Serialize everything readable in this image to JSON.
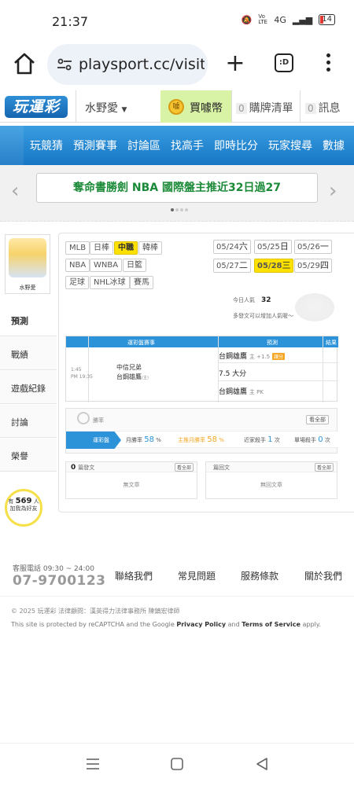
{
  "status_bar": {
    "time": "21:37",
    "signal_label": "Vo LTE",
    "network": "4G",
    "battery": "14"
  },
  "browser": {
    "url": "playsport.cc/visit",
    "tab_count": ":D"
  },
  "header": {
    "logo": "玩運彩",
    "user": "水野愛",
    "buy_coin": "買噱幣",
    "cart_count": "0",
    "cart": "購牌清單",
    "msg_count": "0",
    "msg": "訊息"
  },
  "nav": {
    "items": [
      "玩競猜",
      "預測賽事",
      "討論區",
      "找高手",
      "即時比分",
      "玩家搜尋",
      "數據"
    ]
  },
  "banner": {
    "text": "奪命書勝劍 NBA 國際盤主推近32日過27"
  },
  "sidebar": {
    "username": "水野愛",
    "items": [
      "預測",
      "戰績",
      "遊戲紀錄",
      "討論",
      "榮譽"
    ],
    "viewers_prefix": "有",
    "viewers_count": "569",
    "viewers_suffix": "人",
    "viewers_line2": "加我為好友"
  },
  "leagues": [
    "MLB",
    "日棒",
    "中職",
    "韓棒",
    "NBA",
    "WNBA",
    "日籃",
    "足球",
    "NHL冰球",
    "賽馬"
  ],
  "selected_league": "中職",
  "dates": [
    {
      "d": "05/24",
      "w": "六"
    },
    {
      "d": "05/25",
      "w": "日"
    },
    {
      "d": "05/26",
      "w": "一"
    },
    {
      "d": "05/27",
      "w": "二"
    },
    {
      "d": "05/28",
      "w": "三"
    },
    {
      "d": "05/29",
      "w": "四"
    }
  ],
  "selected_date": "05/28",
  "popularity": {
    "label": "今日人氣",
    "value": "32"
  },
  "tip": "多發文可以增加人氣喔～",
  "prediction_table": {
    "headers": [
      "運彩盤賽事",
      "預測",
      "結果"
    ],
    "game_time": "1:45",
    "game_clock": "PM 19:35",
    "away_team": "中信兄弟",
    "home_team": "台鋼雄鷹",
    "home_tag": "(主)",
    "picks": [
      {
        "team": "台鋼雄鷹",
        "detail": "主 +1.5",
        "badge": "讓分"
      },
      {
        "team": "7.5 大分",
        "detail": "",
        "badge": ""
      },
      {
        "team": "台鋼雄鷹",
        "detail": "主 PK",
        "badge": ""
      }
    ]
  },
  "stats": {
    "title": "勝率",
    "more": "看全部",
    "tab": "運彩盤",
    "month_label": "月勝率",
    "month_value": "58",
    "month_unit": "%",
    "main_label": "主推月勝率",
    "main_value": "58",
    "main_unit": "%",
    "recent_label": "近家殺手",
    "recent_value": "1",
    "recent_unit": "次",
    "single_label": "單場殺手",
    "single_value": "0",
    "single_unit": "次"
  },
  "boards": [
    {
      "count": "0",
      "label": "篇發文",
      "more": "看全部",
      "empty": "無文章"
    },
    {
      "count": "",
      "label": "篇回文",
      "more": "看全部",
      "empty": "無回文章"
    }
  ],
  "footer": {
    "service_label": "客服電話 09:30 ~ 24:00",
    "phone": "07-9700123",
    "links": [
      "聯絡我們",
      "常見問題",
      "服務條款",
      "關於我們"
    ],
    "copyright": "© 2025 玩運彩  法律顧問：漢英得力法律事務所 陳鎮宏律師",
    "recaptcha_pre": "This site is protected by reCAPTCHA and the Google",
    "privacy": "Privacy Policy",
    "and": "and",
    "terms": "Terms of Service",
    "apply": "apply."
  },
  "colors": {
    "nav_blue": "#1676c5",
    "accent_yellow": "#ffe100",
    "banner_green": "#1b8a38",
    "coin_green": "#d9f3a6"
  }
}
